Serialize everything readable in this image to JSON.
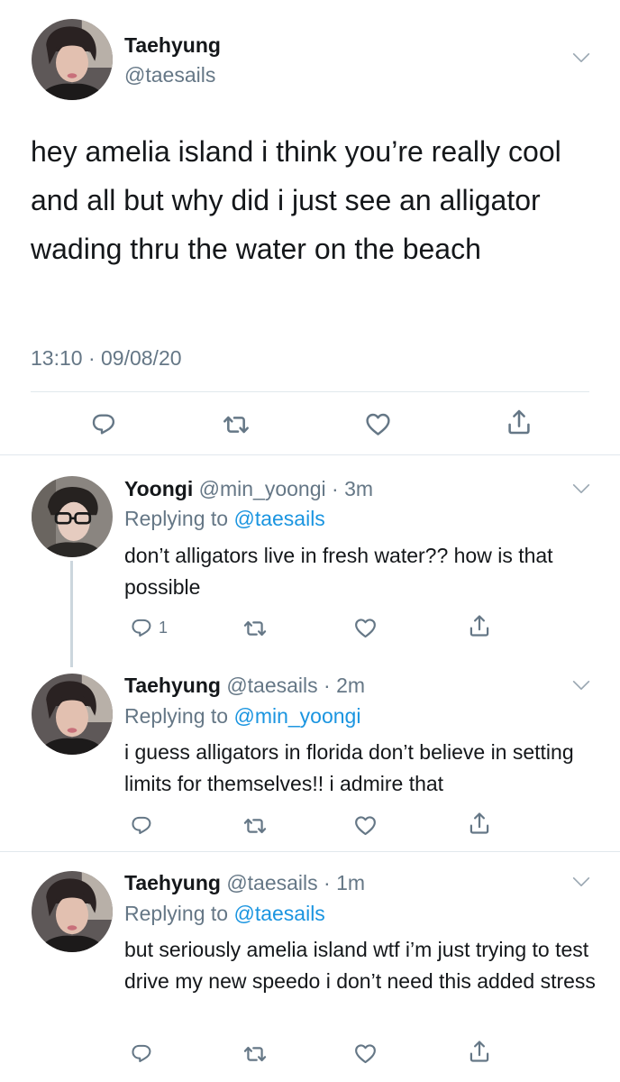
{
  "main_tweet": {
    "name": "Taehyung",
    "handle": "@taesails",
    "text": "hey amelia island i think you’re really cool and all but why did i just see an alligator wading thru the water on the beach",
    "timestamp": "13:10 · 09/08/20"
  },
  "replies": [
    {
      "name": "Yoongi",
      "handle": "@min_yoongi",
      "time": "3m",
      "replying_prefix": "Replying to",
      "replying_to": "@taesails",
      "text": "don’t alligators live in fresh water?? how is that possible",
      "reply_count": "1"
    },
    {
      "name": "Taehyung",
      "handle": "@taesails",
      "time": "2m",
      "replying_prefix": "Replying to",
      "replying_to": "@min_yoongi",
      "text": "i guess alligators in florida don’t believe in setting limits for themselves!! i admire that"
    },
    {
      "name": "Taehyung",
      "handle": "@taesails",
      "time": "1m",
      "replying_prefix": "Replying to",
      "replying_to": "@taesails",
      "text": "but seriously amelia island wtf i’m just trying to test drive my new speedo i don’t need this added stress"
    }
  ],
  "icons": {
    "reply": "reply-icon",
    "retweet": "retweet-icon",
    "like": "heart-icon",
    "share": "share-icon",
    "more": "chevron-down-icon"
  },
  "colors": {
    "text": "#14171a",
    "secondary": "#657786",
    "link": "#1b95e0",
    "divider": "#e1e8ed"
  }
}
